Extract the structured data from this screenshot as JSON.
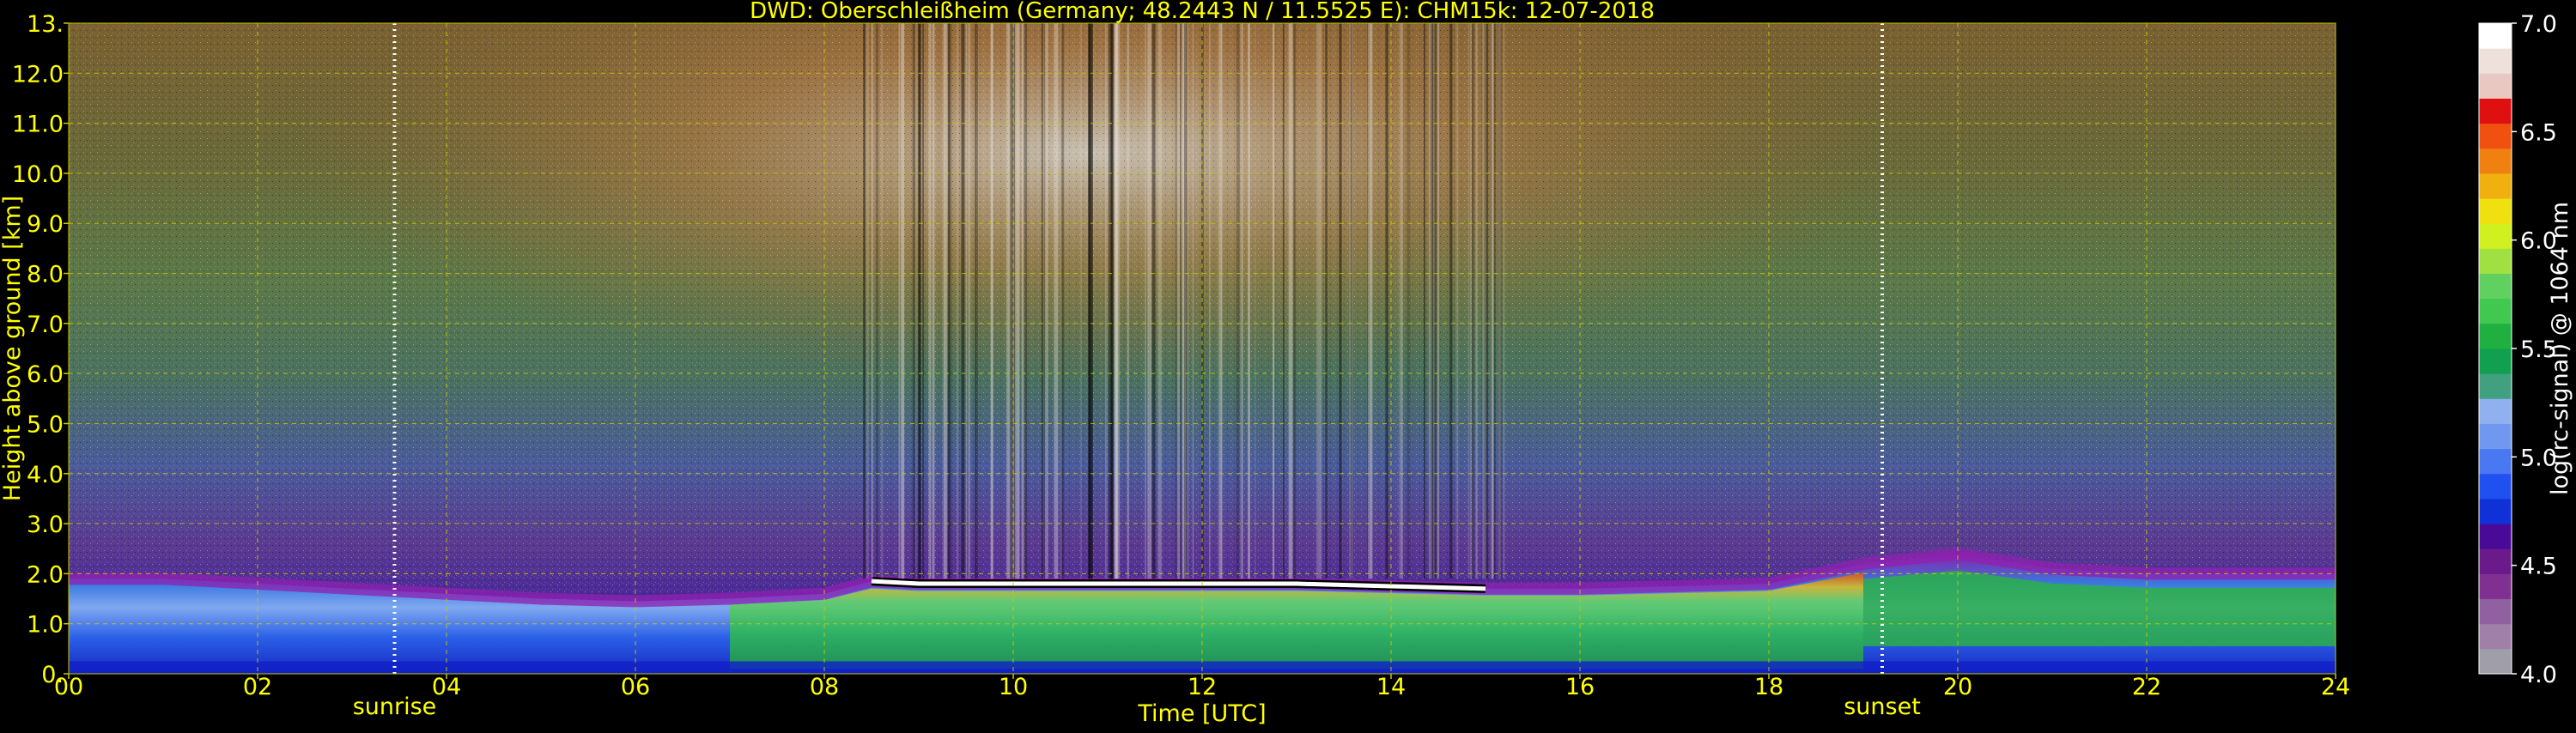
{
  "chart_data": {
    "type": "heatmap",
    "title": "DWD: Oberschleißheim (Germany; 48.2443 N / 11.5525 E):    CHM15k: 12-07-2018",
    "xlabel": "Time [UTC]",
    "ylabel": "Height above ground [km]",
    "xlim": [
      0,
      24
    ],
    "ylim": [
      0,
      13
    ],
    "x_ticks": [
      "00",
      "02",
      "04",
      "06",
      "08",
      "10",
      "12",
      "14",
      "16",
      "18",
      "20",
      "22",
      "24"
    ],
    "y_ticks": [
      "0.",
      "1.0",
      "2.0",
      "3.0",
      "4.0",
      "5.0",
      "6.0",
      "7.0",
      "8.0",
      "9.0",
      "10.0",
      "11.0",
      "12.0",
      "13."
    ],
    "grid": true,
    "annotations": [
      {
        "label": "sunrise",
        "x": 3.45
      },
      {
        "label": "sunset",
        "x": 19.2
      }
    ],
    "colorbar": {
      "label": "log(rc-signal) @ 1064 nm",
      "range": [
        4.0,
        7.0
      ],
      "ticks": [
        "4.0",
        "4.5",
        "5.0",
        "5.5",
        "6.0",
        "6.5",
        "7.0"
      ],
      "colors": [
        "#a09ea8",
        "#a080a8",
        "#9060a0",
        "#803090",
        "#6a1a8a",
        "#4a0a98",
        "#1030d8",
        "#2050f0",
        "#4a78f0",
        "#7098f0",
        "#90b0f0",
        "#40a080",
        "#10a050",
        "#20b040",
        "#40c850",
        "#60d060",
        "#a0e040",
        "#d0f020",
        "#f0e010",
        "#f0b010",
        "#f08010",
        "#f05010",
        "#e01010",
        "#e8c8c0",
        "#f0e0dc",
        "#ffffff"
      ]
    },
    "series": [
      {
        "values": [
          [
            0,
            1.9
          ],
          [
            1,
            1.9
          ],
          [
            2,
            1.8
          ],
          [
            3,
            1.7
          ],
          [
            4,
            1.6
          ],
          [
            5,
            1.5
          ],
          [
            6,
            1.45
          ],
          [
            7,
            1.5
          ],
          [
            8,
            1.6
          ],
          [
            8.5,
            1.85
          ],
          [
            9,
            1.8
          ],
          [
            10,
            1.8
          ],
          [
            11,
            1.8
          ],
          [
            12,
            1.8
          ],
          [
            13,
            1.8
          ],
          [
            14,
            1.75
          ],
          [
            15,
            1.7
          ],
          [
            16,
            1.7
          ],
          [
            17,
            1.75
          ],
          [
            18,
            1.8
          ],
          [
            19,
            2.2
          ],
          [
            20,
            2.4
          ],
          [
            21,
            2.1
          ],
          [
            22,
            2.0
          ],
          [
            23,
            2.0
          ],
          [
            24,
            2.0
          ]
        ]
      }
    ]
  }
}
